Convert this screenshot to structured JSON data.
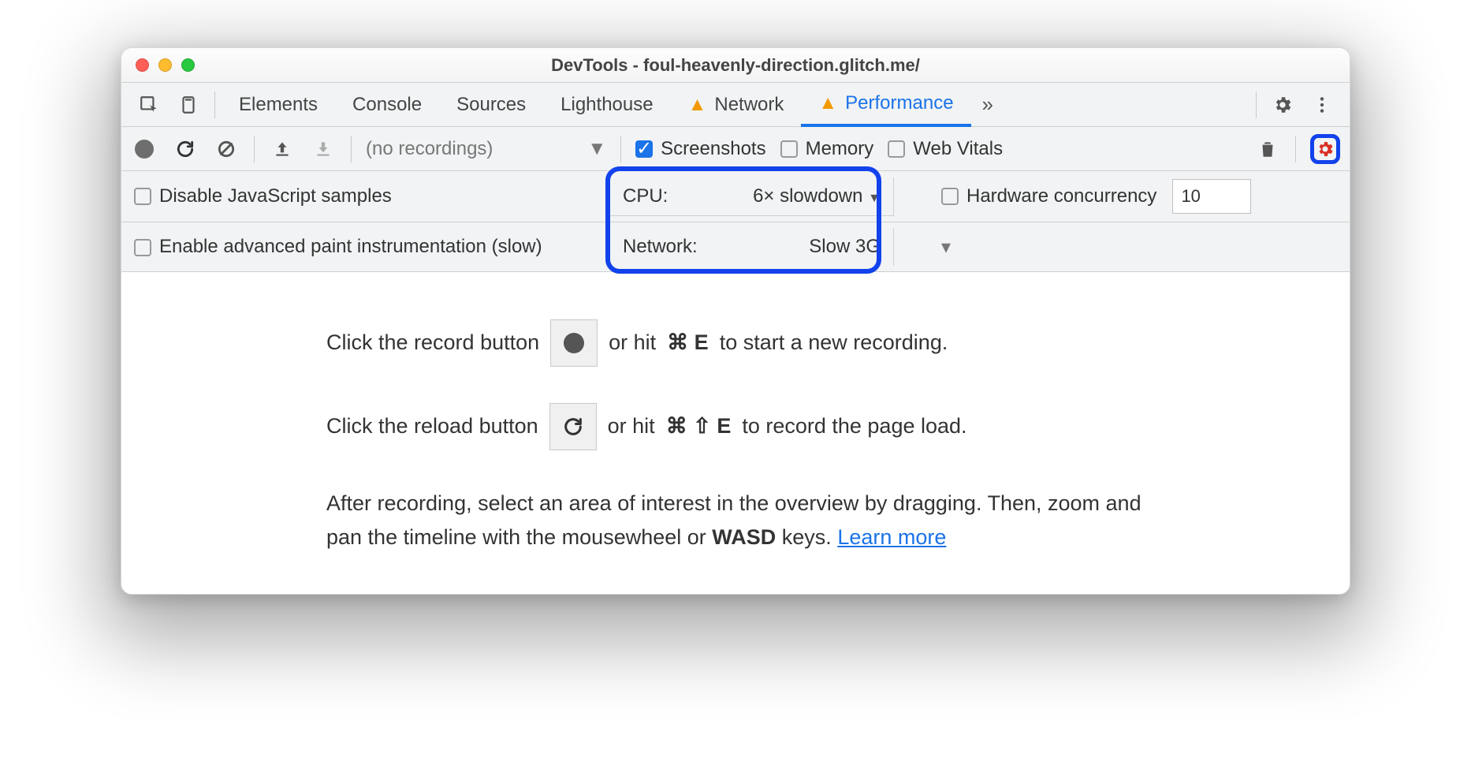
{
  "window": {
    "title": "DevTools - foul-heavenly-direction.glitch.me/"
  },
  "tabs": {
    "items": [
      "Elements",
      "Console",
      "Sources",
      "Lighthouse",
      "Network",
      "Performance"
    ],
    "active": "Performance",
    "more": "»"
  },
  "toolbar": {
    "recordings_label": "(no recordings)",
    "screenshots": {
      "label": "Screenshots",
      "checked": true
    },
    "memory": {
      "label": "Memory",
      "checked": false
    },
    "webvitals": {
      "label": "Web Vitals",
      "checked": false
    }
  },
  "settings": {
    "disable_js": {
      "label": "Disable JavaScript samples",
      "checked": false
    },
    "cpu": {
      "label": "CPU:",
      "value": "6× slowdown"
    },
    "hw": {
      "label": "Hardware concurrency",
      "value": "10",
      "checked": false
    },
    "paint": {
      "label": "Enable advanced paint instrumentation (slow)",
      "checked": false
    },
    "network": {
      "label": "Network:",
      "value": "Slow 3G"
    }
  },
  "content": {
    "l1a": "Click the record button",
    "l1b": "or hit",
    "l1k": "⌘ E",
    "l1c": "to start a new recording.",
    "l2a": "Click the reload button",
    "l2b": "or hit",
    "l2k": "⌘ ⇧ E",
    "l2c": "to record the page load.",
    "l3a": "After recording, select an area of interest in the overview by dragging. Then, zoom and pan the timeline with the mousewheel or ",
    "l3b": "WASD",
    "l3c": " keys. ",
    "learn": "Learn more"
  }
}
